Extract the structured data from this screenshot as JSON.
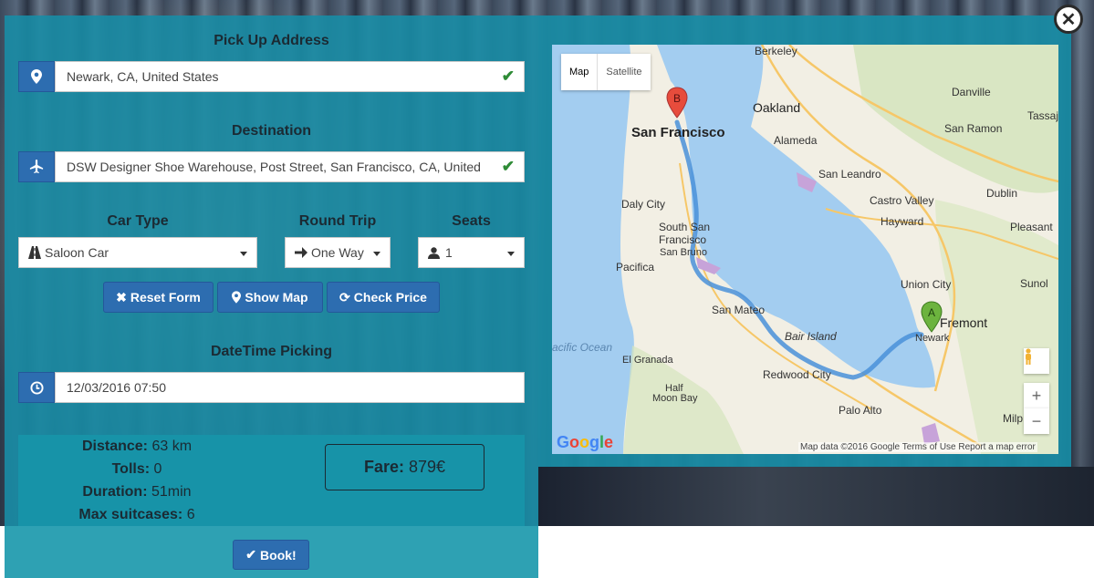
{
  "form": {
    "pickup": {
      "title": "Pick Up Address",
      "value": "Newark, CA, United States",
      "icon": "map-marker-icon"
    },
    "destination": {
      "title": "Destination",
      "value": "DSW Designer Shoe Warehouse, Post Street, San Francisco, CA, United",
      "icon": "plane-icon"
    },
    "car_type": {
      "title": "Car Type",
      "value": "Saloon Car",
      "icon": "road-icon"
    },
    "round_trip": {
      "title": "Round Trip",
      "value": "One Way",
      "icon": "arrow-right-icon"
    },
    "seats": {
      "title": "Seats",
      "value": "1",
      "icon": "user-icon"
    },
    "datetime": {
      "title": "DateTime Picking",
      "value": "12/03/2016 07:50",
      "icon": "clock-icon"
    }
  },
  "buttons": {
    "reset": "Reset Form",
    "show_map": "Show Map",
    "check_price": "Check Price",
    "book": "Book!"
  },
  "summary": {
    "distance_label": "Distance:",
    "distance_value": "63 km",
    "tolls_label": "Tolls:",
    "tolls_value": "0",
    "duration_label": "Duration:",
    "duration_value": "51min",
    "suitcases_label": "Max suitcases:",
    "suitcases_value": "6",
    "fare_label": "Fare:",
    "fare_value": "879€"
  },
  "map": {
    "tab_map": "Map",
    "tab_satellite": "Satellite",
    "marker_a": "A",
    "marker_b": "B",
    "zoom_in": "+",
    "zoom_out": "−",
    "attribution": "Map data ©2016 Google    Terms of Use    Report a map error",
    "google": "Google",
    "labels": {
      "berkeley": "Berkeley",
      "oakland": "Oakland",
      "alameda": "Alameda",
      "san_francisco": "San Francisco",
      "danville": "Danville",
      "tassaj": "Tassaj",
      "san_ramon": "San Ramon",
      "san_leandro": "San Leandro",
      "castro_valley": "Castro Valley",
      "dublin": "Dublin",
      "hayward": "Hayward",
      "pleasant": "Pleasant",
      "daly_city": "Daly City",
      "south_sf_1": "South San",
      "south_sf_2": "Francisco",
      "san_bruno": "San Bruno",
      "pacifica": "Pacifica",
      "union_city": "Union City",
      "sunol": "Sunol",
      "fremont": "Fremont",
      "newark": "Newark",
      "san_mateo": "San Mateo",
      "bair_island": "Bair Island",
      "pacific_ocean": "acific Ocean",
      "el_granada": "El Granada",
      "redwood_city": "Redwood City",
      "half_moon_bay_1": "Half",
      "half_moon_bay_2": "Moon Bay",
      "palo_alto": "Palo Alto",
      "milp": "Milp"
    }
  },
  "colors": {
    "panel": "#188ca5",
    "button": "#2d6db0",
    "check": "#2e8b36",
    "route": "#4a90d9",
    "marker_a": "#6cb33e",
    "marker_b": "#e74c3c"
  }
}
